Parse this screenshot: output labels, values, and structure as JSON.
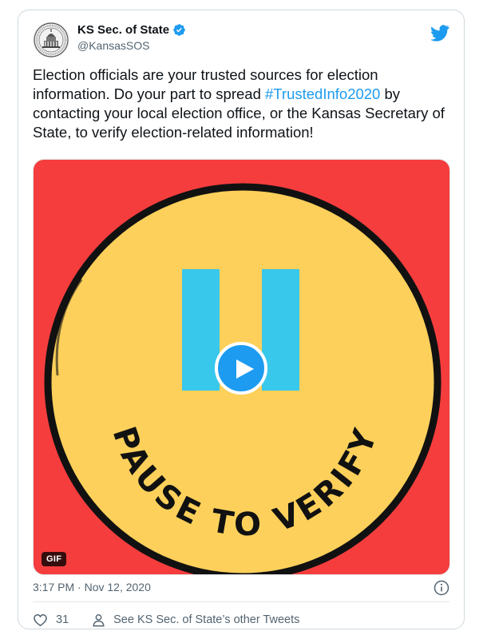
{
  "account": {
    "display_name": "KS Sec. of State",
    "handle": "@KansasSOS",
    "verified": true
  },
  "tweet": {
    "text_before": "Election officials are your trusted sources for election information. Do your part to spread ",
    "hashtag": "#TrustedInfo2020",
    "text_after": " by contacting your local election office, or the Kansas Secretary of State, to verify election-related information!"
  },
  "media": {
    "type": "gif",
    "badge_label": "GIF",
    "artwork_text": "PAUSE TO VERIFY"
  },
  "meta": {
    "timestamp": "3:17 PM · Nov 12, 2020"
  },
  "actions": {
    "like_count": "31",
    "other_tweets_label": "See KS Sec. of State’s other Tweets"
  },
  "colors": {
    "accent": "#1d9bf0",
    "media_background": "#f53d3d",
    "circle_fill": "#fcd05a",
    "pause_bars": "#38c8ec"
  },
  "icons": {
    "brand": "twitter-bird-icon",
    "verified": "verified-badge-icon",
    "play": "play-icon",
    "info": "info-icon",
    "like": "heart-icon",
    "profile": "person-icon"
  }
}
